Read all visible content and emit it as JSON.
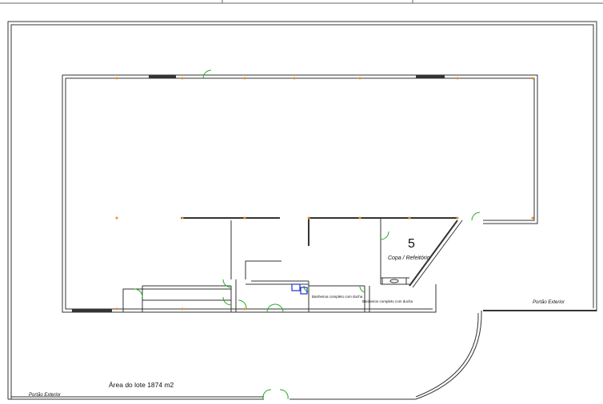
{
  "labels": {
    "room_number": "5",
    "room_name": "Copa / Refeitório",
    "bathroom_1": "Banheiroa completo com ducha",
    "bathroom_2": "Banheiros completo com ducha",
    "gate_right": "Portão Exterior",
    "gate_left": "Portão Exterior",
    "lot_area": "Área do lote 1874 m2"
  },
  "colors": {
    "wall": "#333333",
    "door_swing": "#22aa22",
    "light_point": "#f08a24",
    "fixture": "#2233cc"
  },
  "icons": [
    "door-swing-icon",
    "light-point-icon",
    "sink-icon",
    "toilet-icon"
  ]
}
